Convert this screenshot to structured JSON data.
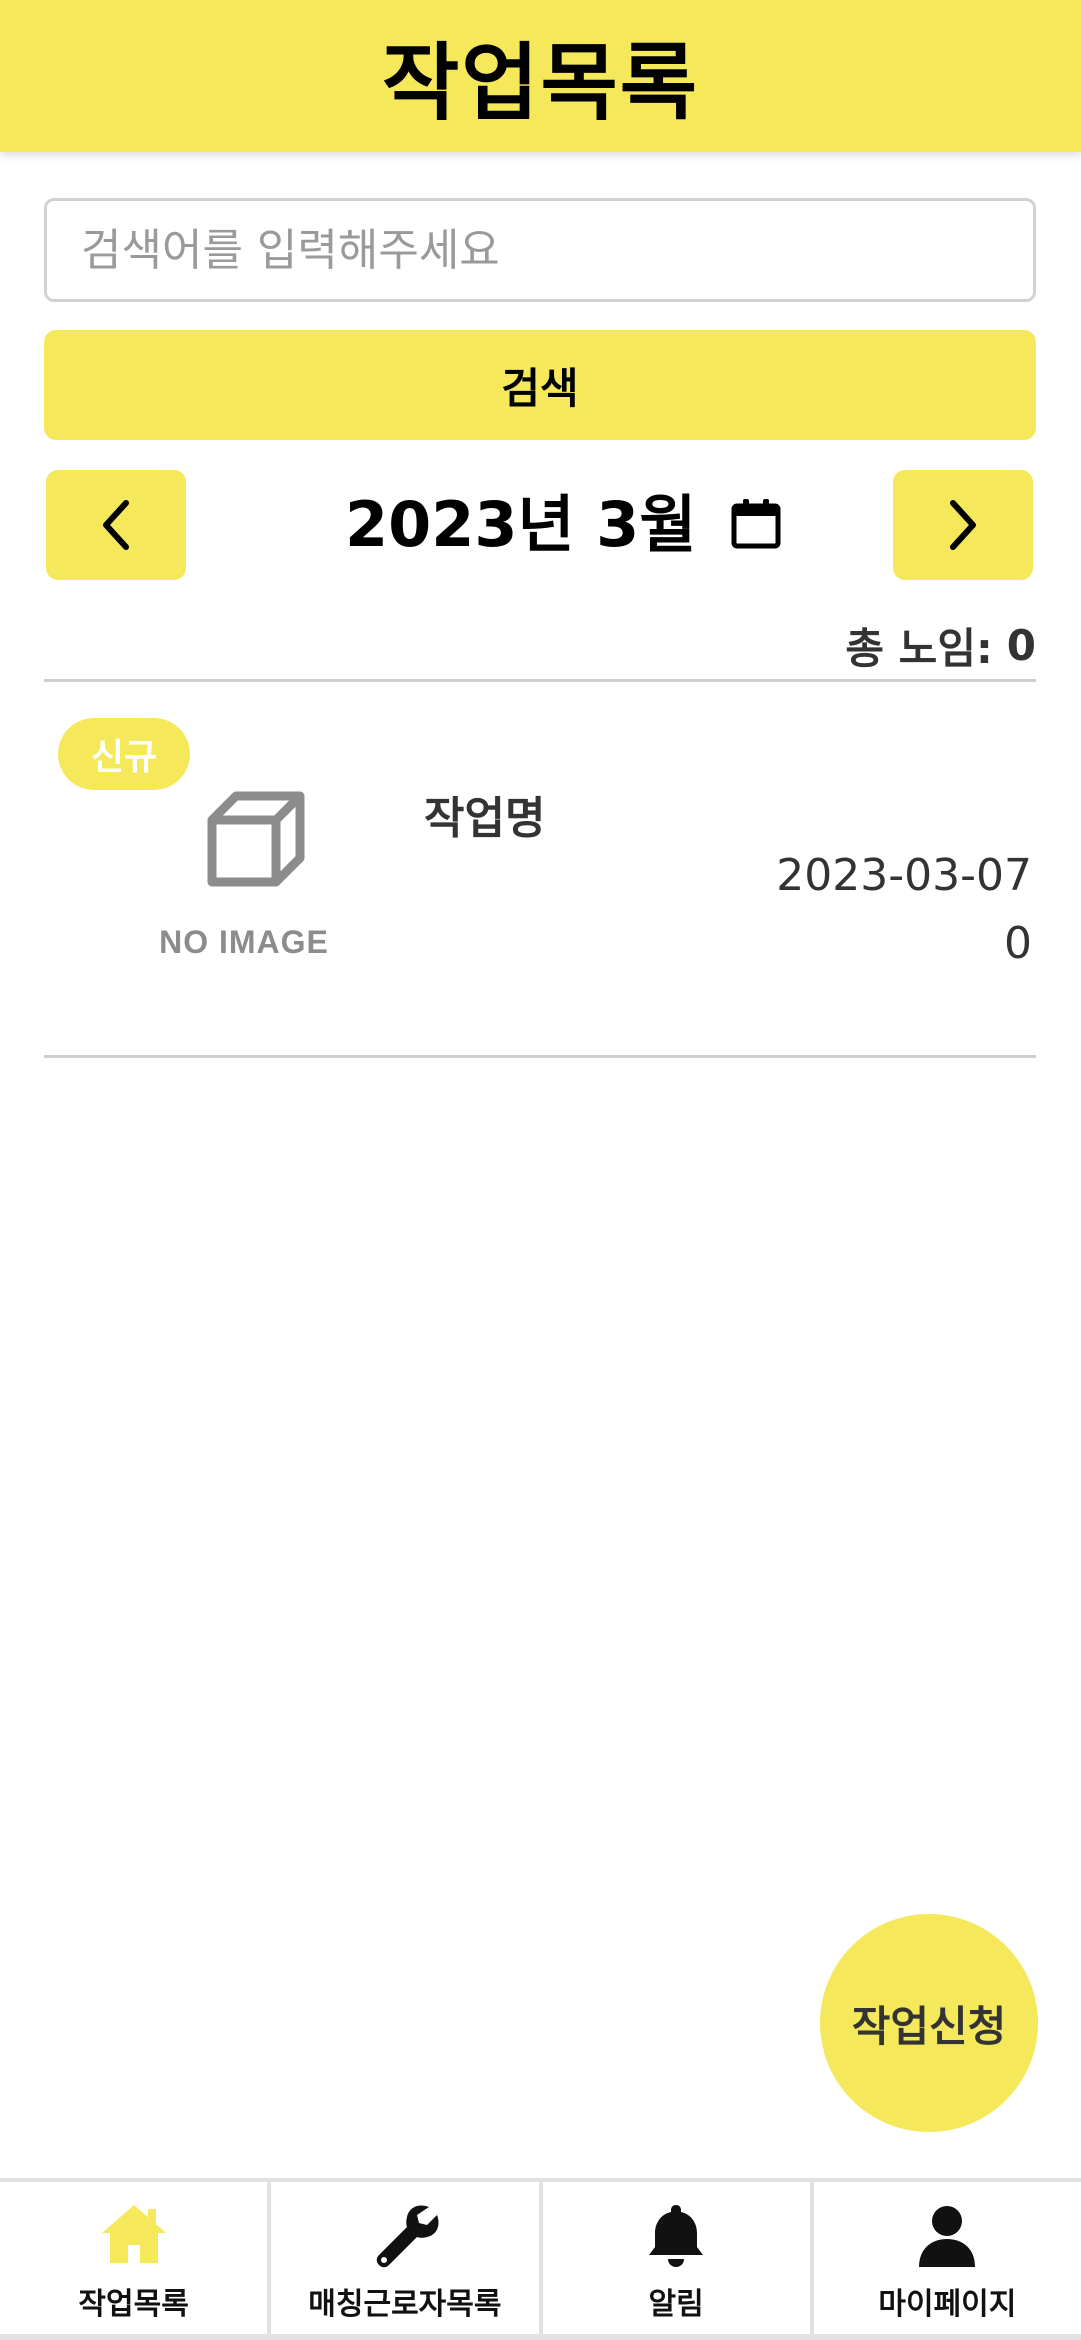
{
  "header": {
    "title": "작업목록"
  },
  "search": {
    "placeholder": "검색어를 입력해주세요",
    "value": "",
    "button_label": "검색"
  },
  "month_nav": {
    "label": "2023년 3월",
    "prev_icon": "chevron-left-icon",
    "next_icon": "chevron-right-icon",
    "calendar_icon": "calendar-icon"
  },
  "summary": {
    "total_label": "총 노임:",
    "total_value": "0"
  },
  "jobs": [
    {
      "badge": "신규",
      "thumbnail_text": "NO IMAGE",
      "title": "작업명",
      "date": "2023-03-07",
      "amount": "0"
    }
  ],
  "fab": {
    "label": "작업신청"
  },
  "tabs": [
    {
      "label": "작업목록",
      "icon": "home-icon",
      "active": true
    },
    {
      "label": "매칭근로자목록",
      "icon": "wrench-icon",
      "active": false
    },
    {
      "label": "알림",
      "icon": "bell-icon",
      "active": false
    },
    {
      "label": "마이페이지",
      "icon": "person-icon",
      "active": false
    }
  ],
  "colors": {
    "accent": "#f6e85b",
    "text": "#111111",
    "muted": "#9a9a9a",
    "divider": "#cfcfcf"
  }
}
